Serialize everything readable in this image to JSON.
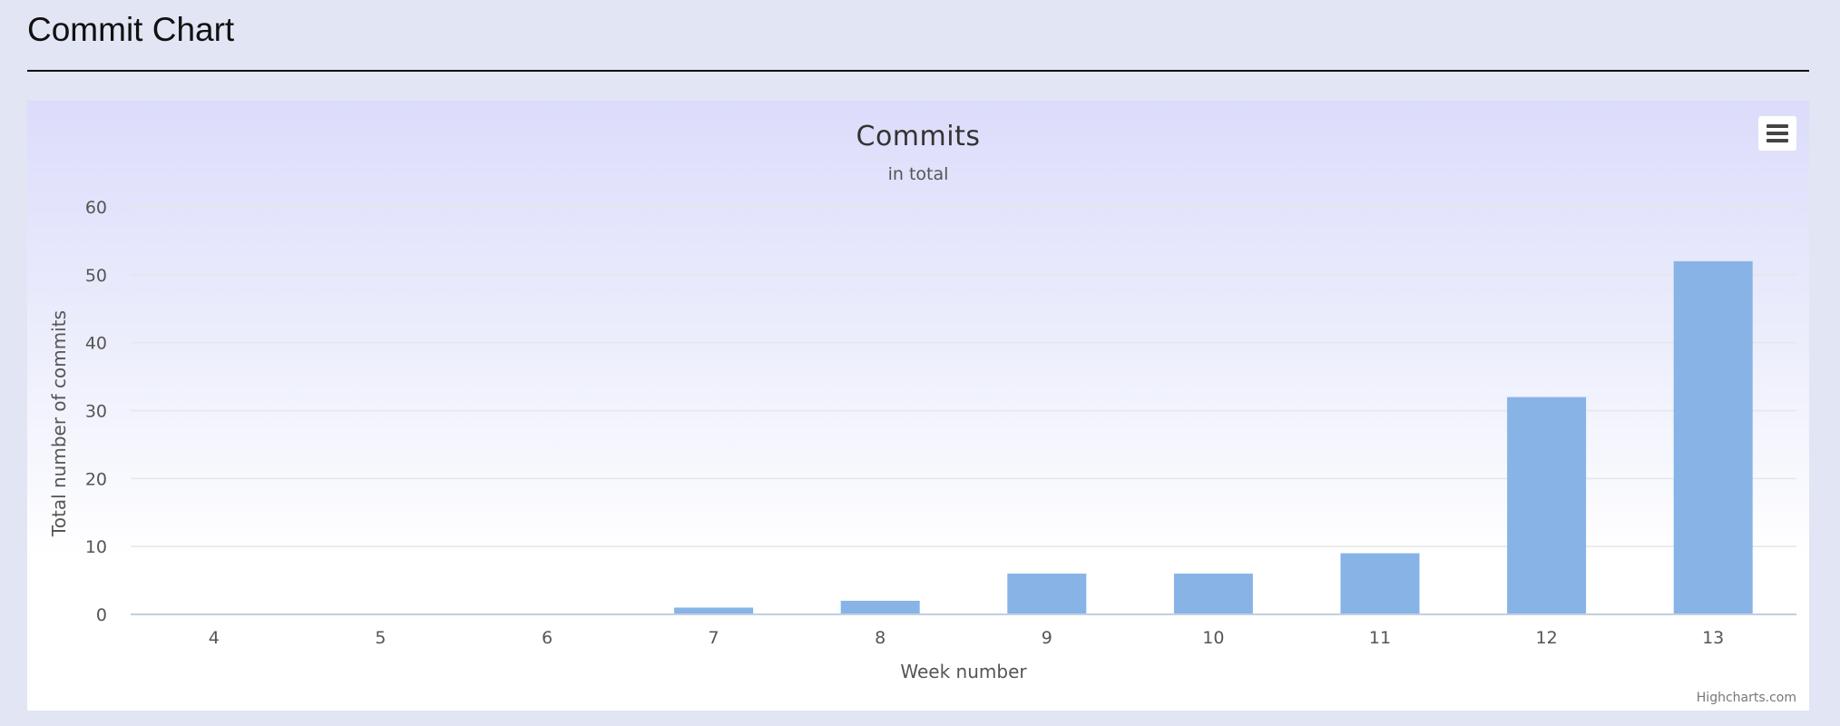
{
  "header": {
    "title": "Commit Chart"
  },
  "chart_data": {
    "type": "bar",
    "title": "Commits",
    "subtitle": "in total",
    "xlabel": "Week number",
    "ylabel": "Total number of commits",
    "categories": [
      "4",
      "5",
      "6",
      "7",
      "8",
      "9",
      "10",
      "11",
      "12",
      "13"
    ],
    "values": [
      0,
      0,
      0,
      1,
      2,
      6,
      6,
      9,
      32,
      52
    ],
    "ylim": [
      0,
      60
    ],
    "yticks": [
      0,
      10,
      20,
      30,
      40,
      50,
      60
    ],
    "grid": true,
    "legend": false,
    "bar_color": "#87b3e6",
    "credits": "Highcharts.com"
  },
  "menu": {
    "icon": "hamburger-menu-icon"
  }
}
